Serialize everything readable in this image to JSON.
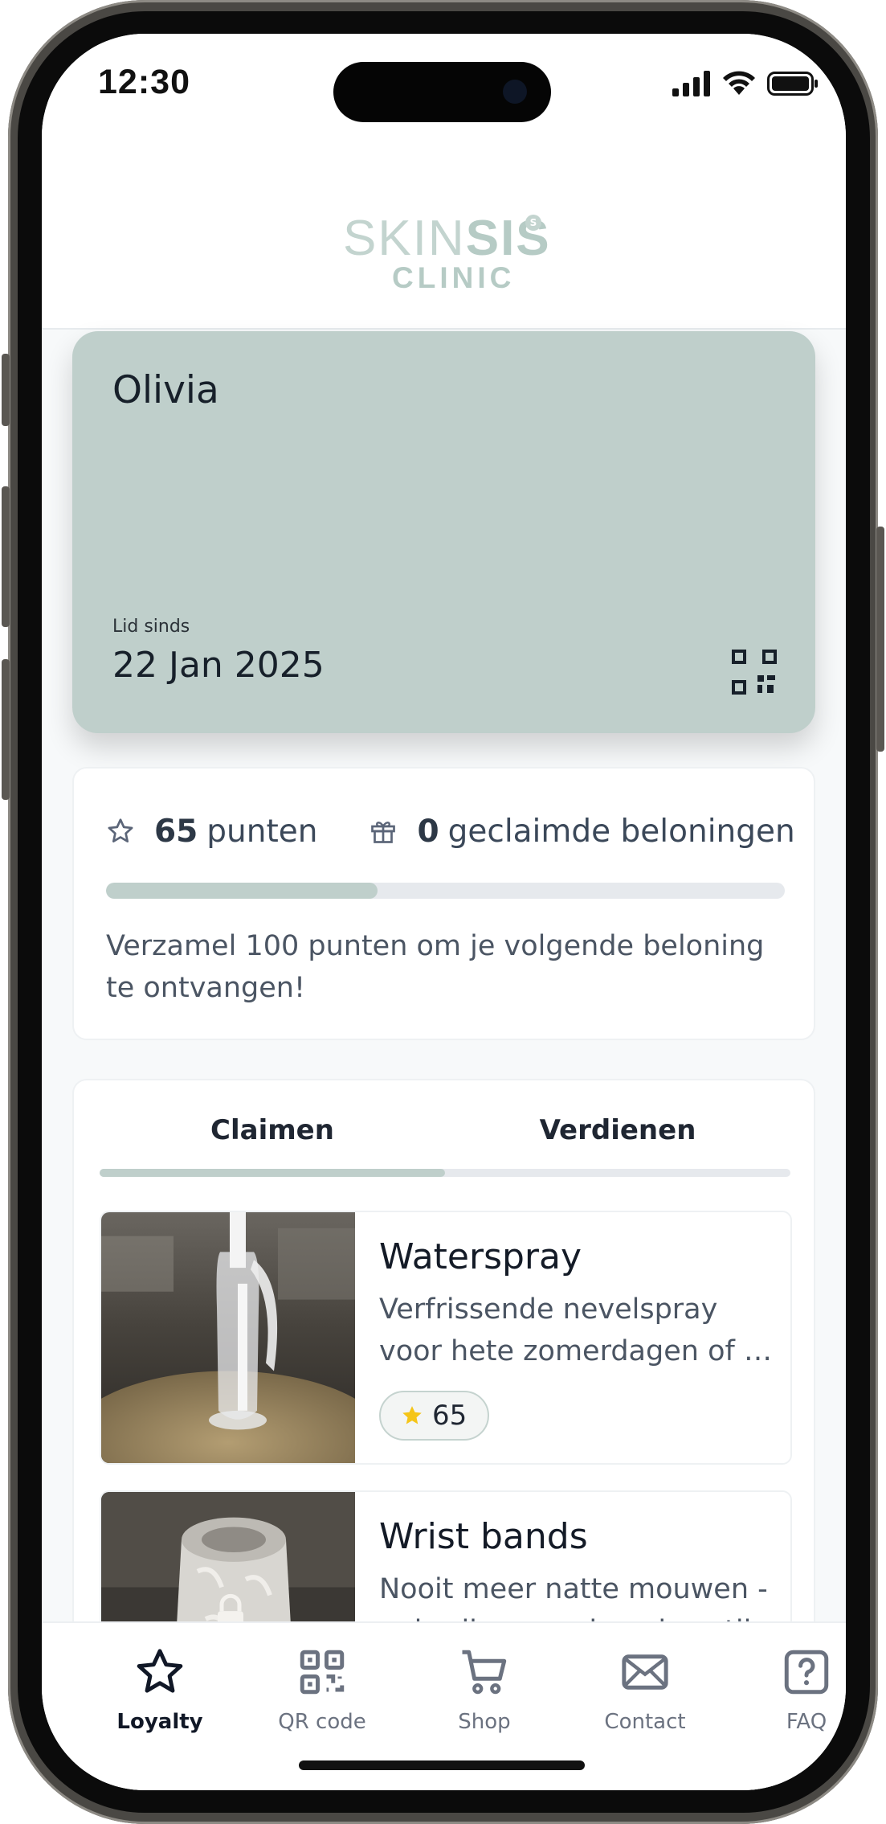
{
  "status_bar": {
    "time": "12:30"
  },
  "brand": {
    "logo_top_light": "SKIN",
    "logo_top_bold": "SIS",
    "logo_bottom": "CLINIC",
    "logo_badge": "S",
    "accent": "#bfcfcb"
  },
  "member_card": {
    "name": "Olivia",
    "since_label": "Lid sinds",
    "since_date": "22 Jan 2025",
    "qr_icon": "qr-code-icon"
  },
  "points": {
    "count": "65",
    "count_label": "punten",
    "rewards_count": "0",
    "rewards_label": "geclaimde beloningen",
    "progress_fraction": 0.4,
    "note": "Verzamel 100 punten om je volgende beloning te ontvangen!"
  },
  "tabs": [
    {
      "label": "Claimen",
      "active": true
    },
    {
      "label": "Verdienen",
      "active": false
    }
  ],
  "rewards": [
    {
      "title": "Waterspray",
      "desc_line1": "Verfrissende nevelspray",
      "desc_line2": "voor hete zomerdagen of t...",
      "points": "65"
    },
    {
      "title": "Wrist bands",
      "desc_line1": "Nooit meer natte mouwen -",
      "desc_line2": "gebruik ze om je polsen tij..."
    }
  ],
  "nav": [
    {
      "label": "Loyalty",
      "icon": "star-icon",
      "active": true
    },
    {
      "label": "QR code",
      "icon": "qr-code-icon",
      "active": false
    },
    {
      "label": "Shop",
      "icon": "cart-icon",
      "active": false
    },
    {
      "label": "Contact",
      "icon": "mail-icon",
      "active": false
    },
    {
      "label": "FAQ",
      "icon": "question-icon",
      "active": false
    }
  ]
}
